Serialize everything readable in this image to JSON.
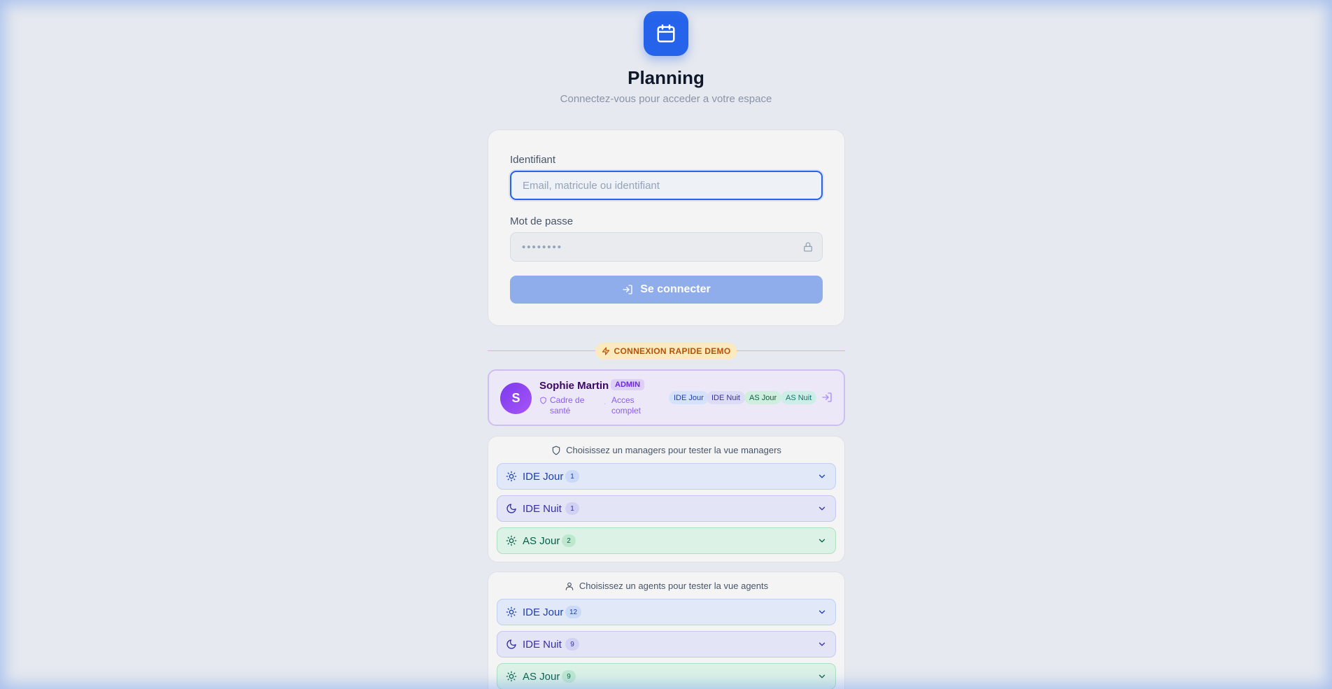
{
  "app": {
    "title": "Planning",
    "subtitle": "Connectez-vous pour acceder a votre espace",
    "logo_icon": "calendar-icon"
  },
  "login": {
    "identifier_label": "Identifiant",
    "identifier_placeholder": "Email, matricule ou identifiant",
    "password_label": "Mot de passe",
    "password_value": "••••••••",
    "submit_label": "Se connecter"
  },
  "demo": {
    "badge": "CONNEXION RAPIDE DEMO",
    "admin": {
      "initial": "S",
      "name": "Sophie Martin",
      "badge": "ADMIN",
      "role": "Cadre de santé",
      "separator": "·",
      "access": "Acces complet",
      "tags": [
        "IDE Jour",
        "IDE Nuit",
        "AS Jour",
        "AS Nuit"
      ]
    }
  },
  "managers": {
    "heading": "Choisissez un managers pour tester la vue managers",
    "groups": [
      {
        "label": "IDE Jour",
        "count": "1",
        "icon": "sun-icon"
      },
      {
        "label": "IDE Nuit",
        "count": "1",
        "icon": "moon-icon"
      },
      {
        "label": "AS Jour",
        "count": "2",
        "icon": "sun-icon"
      }
    ]
  },
  "agents": {
    "heading": "Choisissez un agents pour tester la vue agents",
    "groups": [
      {
        "label": "IDE Jour",
        "count": "12",
        "icon": "sun-icon"
      },
      {
        "label": "IDE Nuit",
        "count": "9",
        "icon": "moon-icon"
      },
      {
        "label": "AS Jour",
        "count": "9",
        "icon": "sun-icon"
      }
    ]
  },
  "colors": {
    "primary": "#2563eb",
    "admin": "#7c3aed",
    "demo": "#b45309"
  }
}
